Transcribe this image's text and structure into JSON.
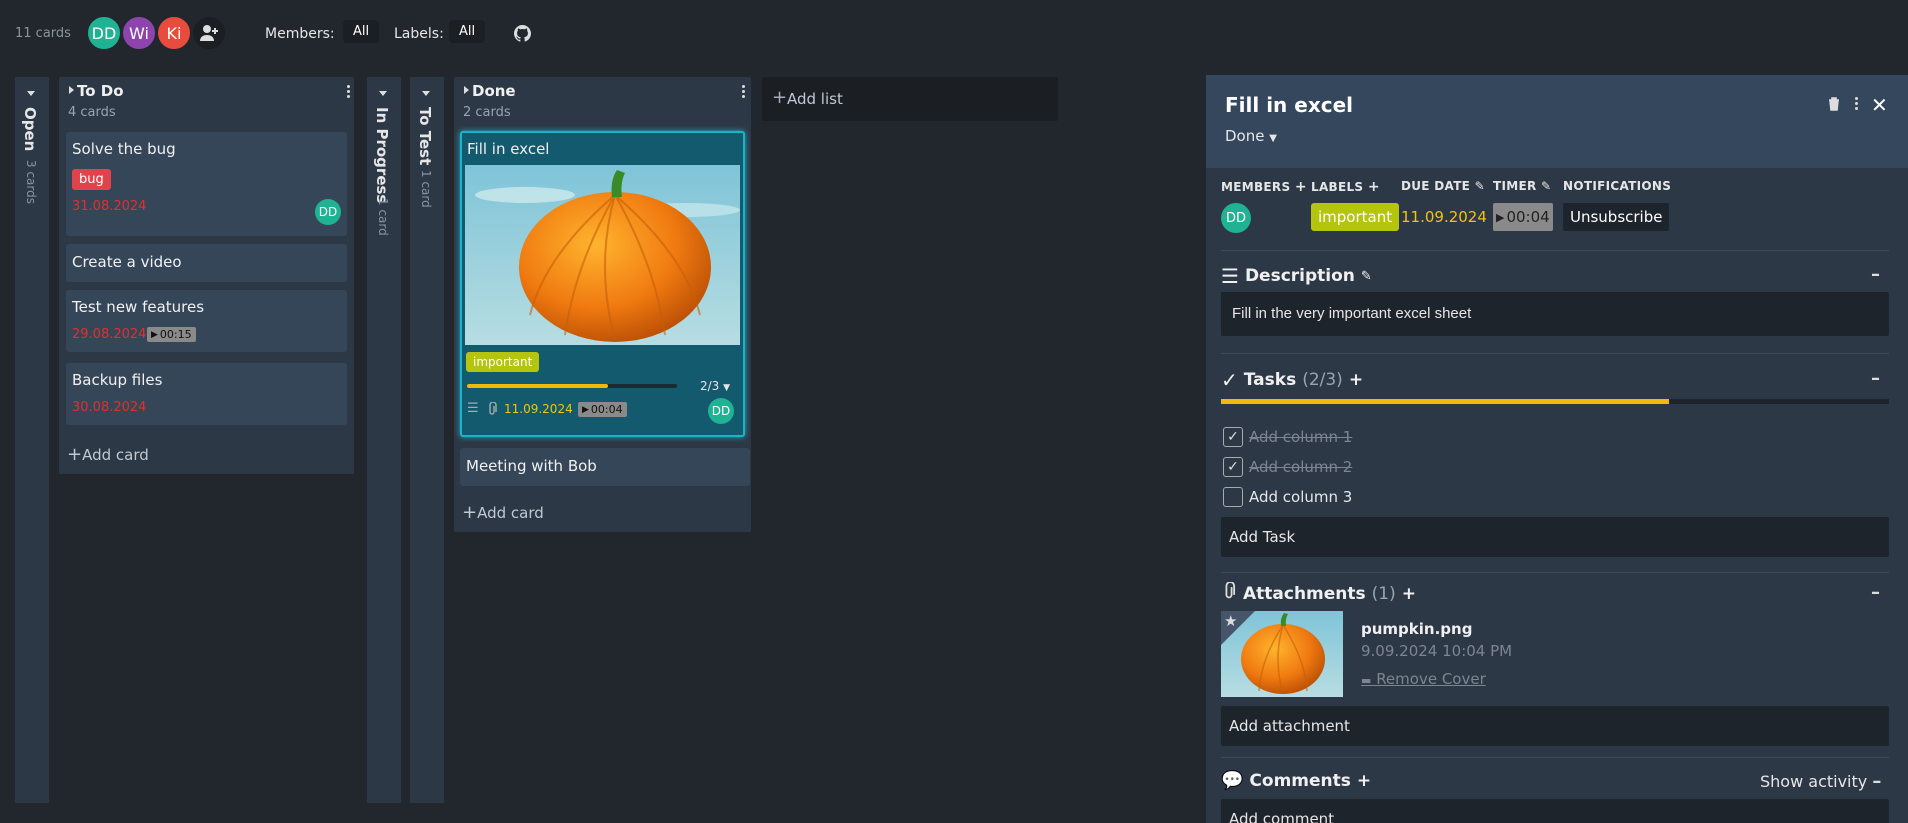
{
  "topbar": {
    "card_count": "11 cards",
    "avatars": [
      {
        "initials": "DD",
        "color": "#1fb394"
      },
      {
        "initials": "Wi",
        "color": "#8e44ad"
      },
      {
        "initials": "Ki",
        "color": "#e74c3c"
      }
    ],
    "members_label": "Members:",
    "members_value": "All",
    "labels_label": "Labels:",
    "labels_value": "All",
    "add_member_icon": "person-add-icon",
    "github_icon": "github-icon"
  },
  "lists": {
    "open": {
      "title": "Open",
      "count": "3 cards"
    },
    "todo": {
      "title": "To Do",
      "count": "4 cards",
      "cards": [
        {
          "title": "Solve the bug",
          "label": "bug",
          "due": "31.08.2024",
          "member": "DD"
        },
        {
          "title": "Create a video"
        },
        {
          "title": "Test new features",
          "due": "29.08.2024",
          "timer": "00:15"
        },
        {
          "title": "Backup files",
          "due": "30.08.2024"
        }
      ],
      "add_card": "Add card"
    },
    "inprogress": {
      "title": "In Progress",
      "count": "1 card"
    },
    "totest": {
      "title": "To Test",
      "count": "1 card"
    },
    "done": {
      "title": "Done",
      "count": "2 cards",
      "cards": [
        {
          "title": "Fill in excel",
          "label": "important",
          "tasks": "2/3",
          "tasks_progress": 0.67,
          "due": "11.09.2024",
          "timer": "00:04",
          "member": "DD"
        },
        {
          "title": "Meeting with Bob"
        }
      ],
      "add_card": "Add card"
    },
    "add_list": "Add list"
  },
  "detail": {
    "title": "Fill in excel",
    "list_name": "Done",
    "members_heading": "MEMBERS",
    "labels_heading": "LABELS",
    "due_heading": "DUE DATE",
    "timer_heading": "TIMER",
    "notifications_heading": "NOTIFICATIONS",
    "member": "DD",
    "label": "important",
    "due": "11.09.2024",
    "timer": "00:04",
    "unsubscribe": "Unsubscribe",
    "description_heading": "Description",
    "description": "Fill in the very important excel sheet",
    "tasks_heading": "Tasks",
    "tasks_count": "(2/3)",
    "tasks_progress": 0.67,
    "tasks": [
      {
        "text": "Add column 1",
        "done": true
      },
      {
        "text": "Add column 2",
        "done": true
      },
      {
        "text": "Add column 3",
        "done": false
      }
    ],
    "add_task": "Add Task",
    "attachments_heading": "Attachments",
    "attachments_count": "(1)",
    "attachment": {
      "name": "pumpkin.png",
      "date": "9.09.2024 10:04 PM",
      "remove_cover": "Remove Cover"
    },
    "add_attachment": "Add attachment",
    "comments_heading": "Comments",
    "show_activity": "Show activity",
    "add_comment": "Add comment"
  },
  "colors": {
    "label_bug": "#e0434b",
    "label_important": "#b5c40d",
    "due_warn": "#f1c40f",
    "progress": "#f0b90b",
    "accent": "#1ab3c8"
  }
}
